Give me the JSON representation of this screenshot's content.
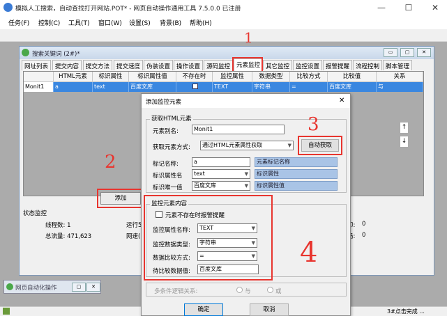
{
  "window": {
    "title": "模拟人工搜索，自动查找打开网站.POT* - 网页自动操作通用工具 7.5.0.0 已注册",
    "minimize_glyph": "—",
    "maximize_glyph": "☐",
    "close_glyph": "✕"
  },
  "menu": [
    "任务(F)",
    "控制(C)",
    "工具(T)",
    "窗口(W)",
    "设置(S)",
    "背景(B)",
    "帮助(H)"
  ],
  "child_window": {
    "title": "搜索关键词 (2#)*",
    "tabs": [
      "网址列表",
      "提交内容",
      "提交方法",
      "提交速度",
      "伪装设置",
      "操作设置",
      "源码监控",
      "元素监控",
      "其它监控",
      "监控设置",
      "报警提醒",
      "流程控制",
      "脚本管理"
    ],
    "active_tab": "元素监控",
    "grid": {
      "columns": [
        "HTML元素",
        "标识属性",
        "标识属性值",
        "不存在时",
        "监控属性",
        "数据类型",
        "比较方式",
        "比较值",
        "关系"
      ],
      "row": {
        "name": "Monit1",
        "html_element": "a",
        "id_attr": "text",
        "id_value": "百度文库",
        "missing": "",
        "monitor_attr": "TEXT",
        "data_type": "字符串",
        "compare": "=",
        "compare_value": "百度文库",
        "relation": "与"
      }
    },
    "up_arrow": "↑",
    "down_arrow": "↓",
    "add_button": "添加",
    "status": {
      "section_label": "状态监控",
      "line1_label": "线程数: 1",
      "line2_label": "总流量: 471,623",
      "run_label": "运行5",
      "net_label": "网速(",
      "right_value_1": "0",
      "right_value_2": "0",
      "right_label_1": "印:",
      "right_label_2": "码:"
    }
  },
  "dialog": {
    "title": "添加监控元素",
    "close_glyph": "✕",
    "group1_caption": "获取HTML元素",
    "alias_label": "元素别名:",
    "alias_value": "Monit1",
    "method_label": "获取元素方式:",
    "method_value": "通过HTML元素属性获取",
    "auto_button": "自动获取",
    "tag_label": "标记名称:",
    "tag_value": "a",
    "tag_info": "元素标记名称",
    "attr_label": "标识属性名",
    "attr_value": "text",
    "attr_info": "标识属性",
    "uniq_label": "标识唯一值",
    "uniq_value": "百度文库",
    "uniq_info": "标识属性值",
    "group2_caption": "监控元素内容",
    "missing_checkbox": "元素不存在时报警提醒",
    "monitor_attr_label": "监控属性名称:",
    "monitor_attr_value": "TEXT",
    "data_type_label": "监控数据类型:",
    "data_type_value": "字符串",
    "compare_label": "数据比较方式:",
    "compare_value": "=",
    "compare_target_label": "待比较数据值:",
    "compare_target_value": "百度文库",
    "logic_label": "多条件逻辑关系:",
    "logic_and": "与",
    "logic_or": "或",
    "ok_button": "确定",
    "cancel_button": "取消"
  },
  "annotations": {
    "n1": "1",
    "n2": "2",
    "n3": "3",
    "n4": "4"
  },
  "minimized_window": {
    "title": "网页自动化操作"
  },
  "statusbar": {
    "right_text": "3#点击完成 ..."
  },
  "colors": {
    "selection": "#3a87e0",
    "annotation": "#e8352f",
    "info_bg": "#a9c4e6"
  }
}
